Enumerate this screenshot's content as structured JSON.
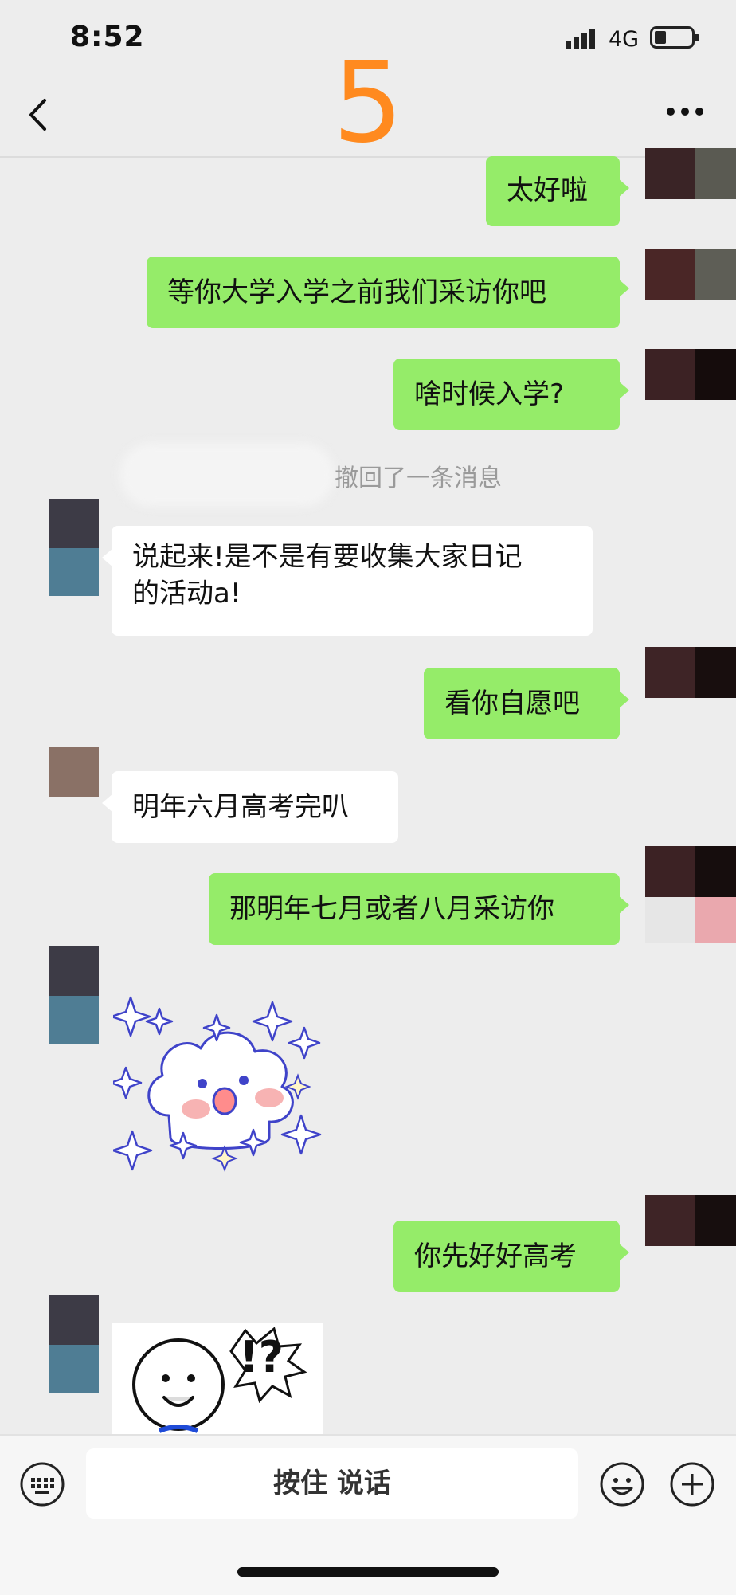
{
  "status_bar": {
    "time": "8:52",
    "network": "4G"
  },
  "header": {
    "title": "5"
  },
  "messages": [
    {
      "side": "right",
      "text": "太好啦"
    },
    {
      "side": "right",
      "text": "等你大学入学之前我们采访你吧"
    },
    {
      "side": "right",
      "text": "啥时候入学?"
    },
    {
      "side": "system",
      "text": "撤回了一条消息"
    },
    {
      "side": "left",
      "line1": "说起来!是不是有要收集大家日记",
      "line2": "的活动a!"
    },
    {
      "side": "right",
      "text": "看你自愿吧"
    },
    {
      "side": "left",
      "text": "明年六月高考完叭"
    },
    {
      "side": "right",
      "text": "那明年七月或者八月采访你"
    },
    {
      "side": "left",
      "type": "sticker",
      "sticker": "sparkle-cloud-sticker"
    },
    {
      "side": "right",
      "text": "你先好好高考"
    },
    {
      "side": "left",
      "type": "sticker",
      "sticker": "surprised-face-sticker",
      "sticker_text": "!?"
    }
  ],
  "input_bar": {
    "voice_label": "按住 说话"
  },
  "colors": {
    "sent_bubble": "#95ec69",
    "received_bubble": "#ffffff",
    "title": "#ff8a1f",
    "background": "#ededed"
  }
}
